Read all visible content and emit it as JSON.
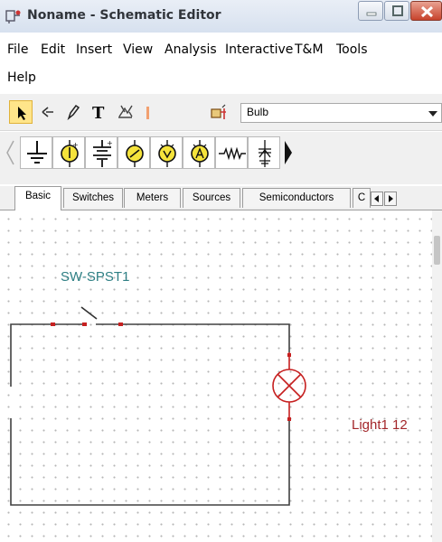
{
  "window": {
    "title": "Noname - Schematic Editor"
  },
  "menu": {
    "items": [
      "File",
      "Edit",
      "Insert",
      "View",
      "Analysis",
      "Interactive",
      "T&M",
      "Tools",
      "Help"
    ]
  },
  "toolbar": {
    "tools": [
      {
        "name": "select-arrow-icon",
        "active": true
      },
      {
        "name": "wire-tool-icon",
        "active": false
      },
      {
        "name": "pencil-icon",
        "active": false
      },
      {
        "name": "text-tool-icon",
        "active": false
      },
      {
        "name": "graph-tool-icon",
        "active": false
      },
      {
        "name": "place-component-icon",
        "active": false
      }
    ],
    "component_select": {
      "value": "Bulb"
    }
  },
  "component_palette": {
    "icons": [
      "ground-icon",
      "dc-ammeter-icon",
      "battery-icon",
      "voltmeter-icon",
      "ac-voltmeter-icon",
      "ac-ammeter-icon",
      "resistor-icon",
      "diode-icon"
    ]
  },
  "tabs": {
    "items": [
      "Basic",
      "Switches",
      "Meters",
      "Sources",
      "Semiconductors",
      "C"
    ],
    "active": "Basic"
  },
  "schematic": {
    "switch_label": "SW-SPST1",
    "light_label": "Light1 12",
    "colors": {
      "wire": "#404040",
      "component": "#c62020",
      "switch_label": "#2e7f84",
      "light_label": "#a3262a"
    }
  }
}
